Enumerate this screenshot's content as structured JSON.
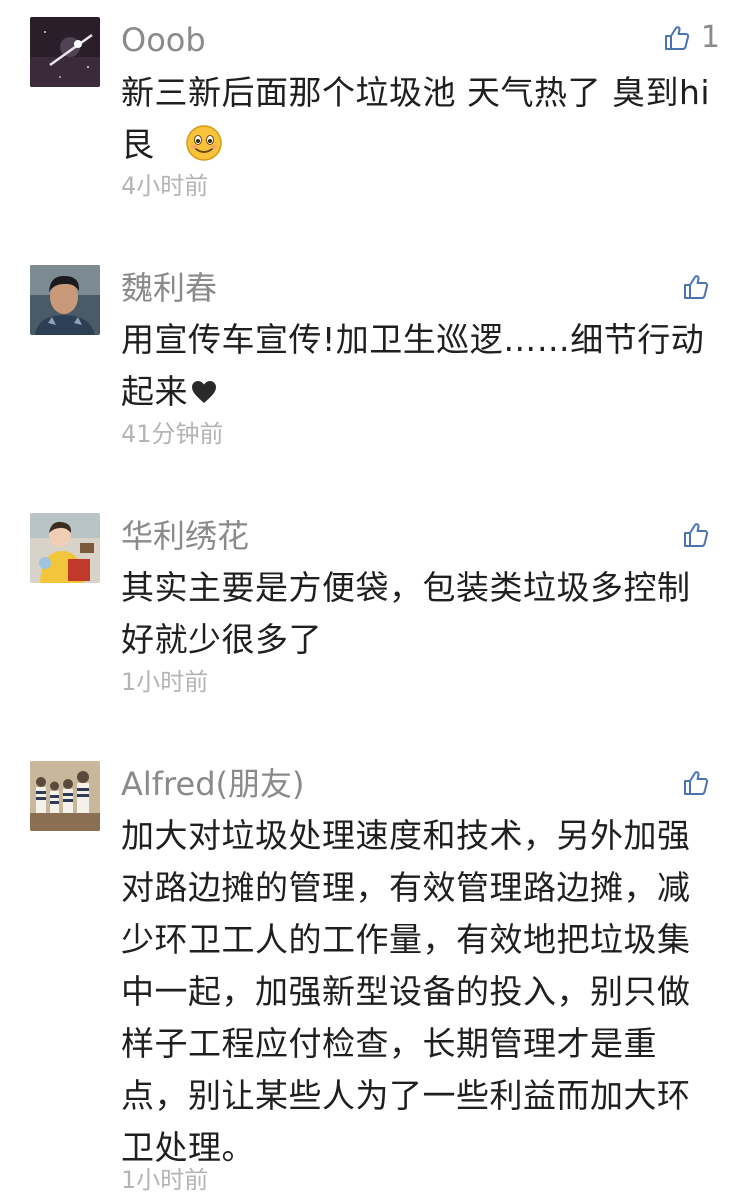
{
  "comments": [
    {
      "name": "Ooob",
      "text": "新三新后面那个垃圾池  天气热了  臭到hi艮",
      "time": "4小时前",
      "likes": "1",
      "avatar_icon": "night-sky-avatar"
    },
    {
      "name": "魏利春",
      "text": "用宣传车宣传!加卫生巡逻……细节行动起来",
      "time": "41分钟前",
      "likes": "",
      "avatar_icon": "man-portrait-avatar"
    },
    {
      "name": "华利绣花",
      "text": "其实主要是方便袋，包装类垃圾多控制好就少很多了",
      "time": "1小时前",
      "likes": "",
      "avatar_icon": "child-photo-avatar"
    },
    {
      "name": "Alfred(朋友)",
      "text": "加大对垃圾处理速度和技术，另外加强对路边摊的管理，有效管理路边摊，减少环卫工人的工作量，有效地把垃圾集中一起，加强新型设备的投入，别只做样子工程应付检查，长期管理才是重点，别让某些人为了一些利益而加大环卫处理。",
      "time": "1小时前",
      "likes": "",
      "avatar_icon": "figurines-avatar"
    }
  ],
  "icons": {
    "like": "thumbs-up-icon",
    "emoji": "smiling-face-emoji",
    "heart": "black-heart-emoji"
  },
  "colors": {
    "name": "#8a8a8a",
    "like_icon": "#4a73b0",
    "time": "#b4b4b4",
    "text": "#1f1f1f"
  }
}
